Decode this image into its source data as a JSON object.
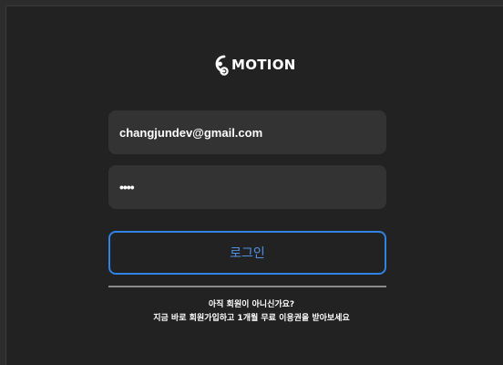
{
  "brand": {
    "name": "MOTION",
    "logo_icon": "motion-logo-icon"
  },
  "login_form": {
    "email_value": "changjundev@gmail.com",
    "password_value": "••••",
    "login_label": "로그인"
  },
  "signup": {
    "question": "아직 회원이 아니신가요?",
    "cta": "지금 바로 회원가입하고 1개월 무료 이용권을 받아보세요"
  },
  "colors": {
    "background": "#222222",
    "field_background": "#333333",
    "accent": "#2f83e4",
    "divider": "#8a8a8a"
  }
}
